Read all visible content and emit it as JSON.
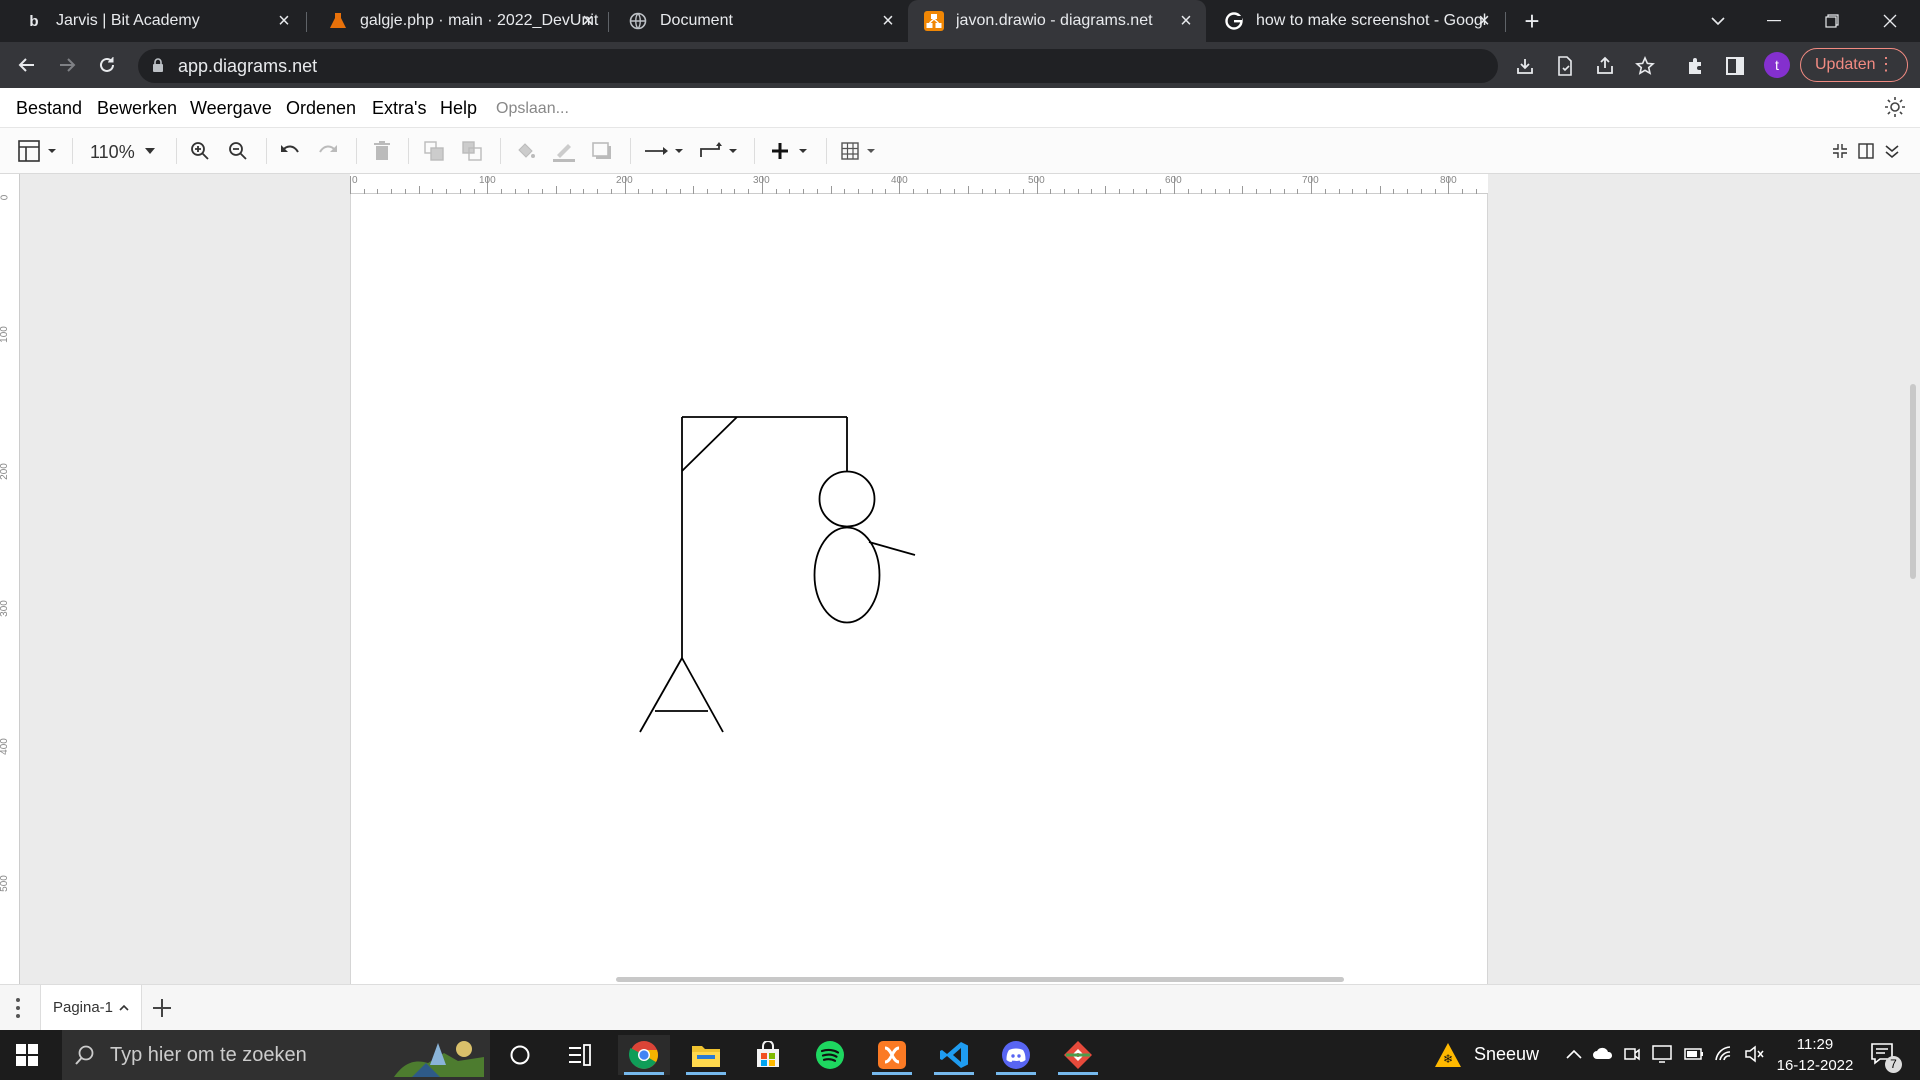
{
  "browser": {
    "tabs": [
      {
        "favicon": "b",
        "title": "Jarvis | Bit Academy"
      },
      {
        "favicon": "flask-icon",
        "title": "galgje.php · main · 2022_DevUnit"
      },
      {
        "favicon": "globe-icon",
        "title": "Document"
      },
      {
        "favicon": "drawio-icon",
        "title": "javon.drawio - diagrams.net"
      },
      {
        "favicon": "google-icon",
        "title": "how to make screenshot - Googl"
      }
    ],
    "url": "app.diagrams.net",
    "avatar_letter": "t",
    "update_label": "Updaten",
    "accent": "#f28b82"
  },
  "menu": {
    "items": [
      "Bestand",
      "Bewerken",
      "Weergave",
      "Ordenen",
      "Extra's",
      "Help"
    ],
    "status": "Opslaan..."
  },
  "toolbar": {
    "zoom": "110%"
  },
  "ruler": {
    "h_labels": [
      "0",
      "100",
      "200",
      "300",
      "400",
      "500",
      "600",
      "700",
      "800"
    ],
    "v_labels": [
      "0",
      "100",
      "200",
      "300",
      "400",
      "500"
    ]
  },
  "pages": {
    "current": "Pagina-1"
  },
  "taskbar": {
    "search_placeholder": "Typ hier om te zoeken",
    "weather": "Sneeuw",
    "time": "11:29",
    "date": "16-12-2022",
    "notifications": "7"
  }
}
